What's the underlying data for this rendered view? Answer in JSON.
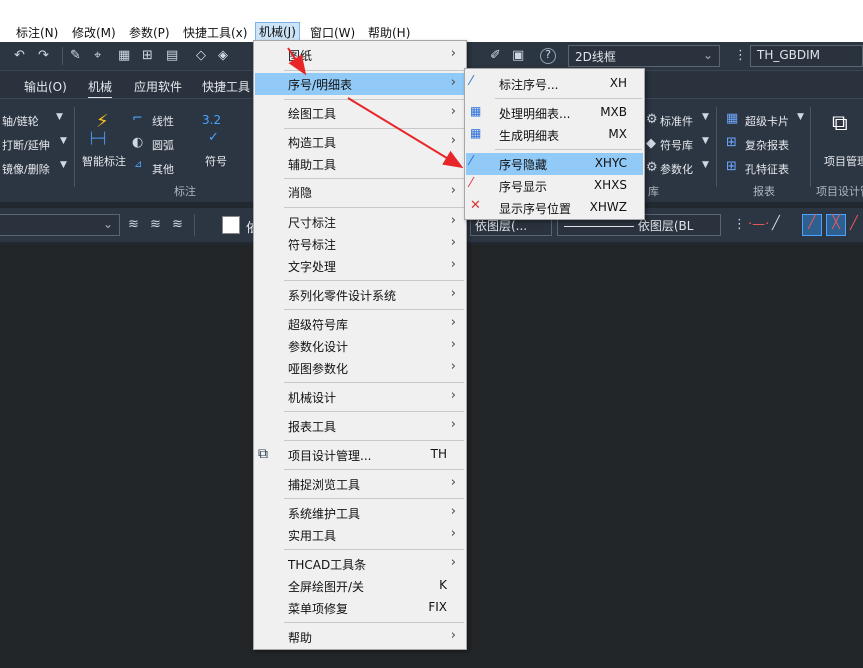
{
  "menubar": {
    "items": [
      {
        "label": "标注(N)"
      },
      {
        "label": "修改(M)"
      },
      {
        "label": "参数(P)"
      },
      {
        "label": "快捷工具(x)"
      },
      {
        "label": "机械(J)"
      },
      {
        "label": "窗口(W)"
      },
      {
        "label": "帮助(H)"
      }
    ]
  },
  "qat": {
    "viewstyle_value": "2D线框",
    "dimstyle_value": "TH_GBDIM"
  },
  "tabs": {
    "items": [
      {
        "label": "输出(O)"
      },
      {
        "label": "机械"
      },
      {
        "label": "应用软件"
      },
      {
        "label": "快捷工具"
      }
    ]
  },
  "ribbon": {
    "left_items": {
      "a": "轴/链轮",
      "b": "打断/延伸",
      "c": "镜像/删除"
    },
    "smart_dim": "智能标注",
    "line": "线性",
    "arc": "圆弧",
    "other": "其他",
    "symbol": "符号",
    "symbol_val": "3.2",
    "group_dim": "标注",
    "std_part": "标准件",
    "sym_lib": "符号库",
    "param": "参数化",
    "group_lib": "库",
    "super_card": "超级卡片",
    "complex_report": "复杂报表",
    "hole_table": "孔特征表",
    "group_report": "报表",
    "proj_mgr": "项目管理",
    "group_proj": "项目设计管"
  },
  "propbar": {
    "layer_char": "依",
    "layer_prefix": "依图层(...",
    "linetype": "依图层(BL"
  },
  "mech_menu": {
    "items": [
      {
        "label": "图纸",
        "arrow": "›"
      },
      {
        "label": "序号/明细表",
        "arrow": "›"
      },
      {
        "label": "绘图工具",
        "arrow": "›"
      },
      {
        "label": "构造工具",
        "arrow": "›"
      },
      {
        "label": "辅助工具",
        "arrow": "›"
      },
      {
        "label": "消隐",
        "arrow": "›"
      },
      {
        "label": "尺寸标注",
        "arrow": "›"
      },
      {
        "label": "符号标注",
        "arrow": "›"
      },
      {
        "label": "文字处理",
        "arrow": "›"
      },
      {
        "label": "系列化零件设计系统",
        "arrow": "›"
      },
      {
        "label": "超级符号库",
        "arrow": "›"
      },
      {
        "label": "参数化设计",
        "arrow": "›"
      },
      {
        "label": "哑图参数化",
        "arrow": "›"
      },
      {
        "label": "机械设计",
        "arrow": "›"
      },
      {
        "label": "报表工具",
        "arrow": "›"
      },
      {
        "label": "项目设计管理...",
        "shortcut": "TH"
      },
      {
        "label": "捕捉浏览工具",
        "arrow": "›"
      },
      {
        "label": "系统维护工具",
        "arrow": "›"
      },
      {
        "label": "实用工具",
        "arrow": "›"
      },
      {
        "label": "THCAD工具条",
        "arrow": "›"
      },
      {
        "label": "全屏绘图开/关",
        "shortcut": "K"
      },
      {
        "label": "菜单项修复",
        "shortcut": "FIX"
      },
      {
        "label": "帮助",
        "arrow": "›"
      }
    ]
  },
  "submenu": {
    "items": [
      {
        "label": "标注序号...",
        "shortcut": "XH"
      },
      {
        "label": "处理明细表...",
        "shortcut": "MXB"
      },
      {
        "label": "生成明细表",
        "shortcut": "MX"
      },
      {
        "label": "序号隐藏",
        "shortcut": "XHYC"
      },
      {
        "label": "序号显示",
        "shortcut": "XHXS"
      },
      {
        "label": "显示序号位置",
        "shortcut": "XHWZ"
      }
    ]
  },
  "colors": {
    "highlight": "#91c9f7",
    "arrow_annotation": "#e8262a",
    "ribbon_bg": "#2c3542",
    "canvas_bg": "#222629"
  }
}
